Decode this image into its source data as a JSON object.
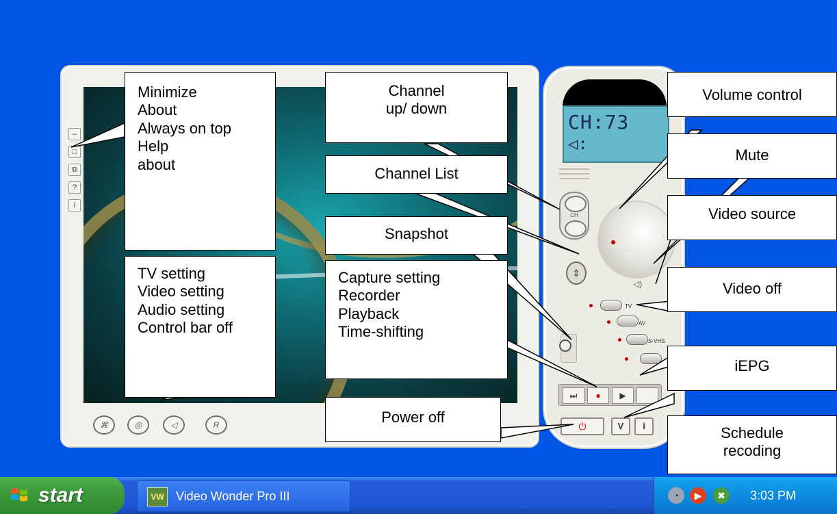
{
  "viewer": {
    "side_buttons": [
      "–",
      "□",
      "⧉",
      "?",
      "i"
    ],
    "bottom_icons": [
      "⌘",
      "◎",
      "◁",
      "R"
    ]
  },
  "remote": {
    "lcd_channel": "CH:73",
    "lcd_volume": "◁:",
    "ch_label": "CH",
    "source_labels": [
      "TV",
      "AV",
      "S-VHS"
    ],
    "transport": [
      "⏭",
      "●",
      "▶",
      ""
    ],
    "power_symbol": "⏻",
    "v_button": "V",
    "i_button": "i"
  },
  "callouts": {
    "window_menu": [
      "Minimize",
      "About",
      "Always on top",
      "Help",
      "about"
    ],
    "channel_updown": [
      "Channel",
      "up/ down"
    ],
    "volume_control": "Volume control",
    "channel_list": "Channel List",
    "mute": "Mute",
    "snapshot": "Snapshot",
    "video_source": "Video source",
    "settings_menu": [
      "TV setting",
      "Video setting",
      "Audio setting",
      "Control bar off"
    ],
    "capture_menu": [
      "Capture setting",
      "Recorder",
      "Playback",
      "Time-shifting"
    ],
    "video_off": "Video off",
    "iepg": "iEPG",
    "power_off": "Power off",
    "schedule": [
      "Schedule",
      "recoding"
    ]
  },
  "taskbar": {
    "start_label": "start",
    "task_label": "Video Wonder Pro III",
    "clock": "3:03 PM"
  },
  "colors": {
    "desktop": "#0055E5",
    "taskbar": "#245EDB",
    "start_green": "#3C9A3C",
    "lcd": "#68B8CB"
  }
}
